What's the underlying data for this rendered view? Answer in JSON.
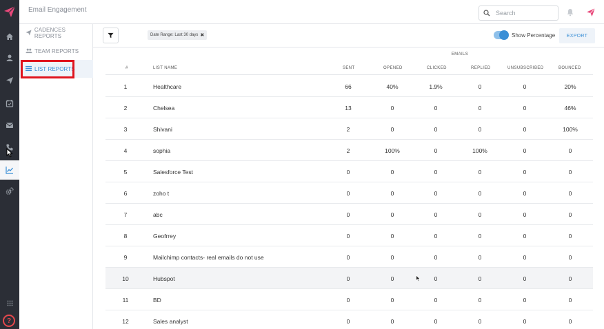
{
  "app": {
    "title": "Email Engagement",
    "brand_color": "#e8487a",
    "accent_color": "#3b8fd6"
  },
  "header": {
    "search_placeholder": "Search",
    "icons": [
      "search-icon",
      "bell-icon",
      "logo-icon"
    ]
  },
  "rail": {
    "items": [
      "home-icon",
      "user-icon",
      "send-icon",
      "calendar-icon",
      "mail-icon",
      "phone-icon",
      "chart-icon",
      "settings-icon"
    ],
    "active": "chart-icon"
  },
  "subnav": {
    "items": [
      {
        "label": "CADENCES REPORTS",
        "icon": "send-icon",
        "active": false
      },
      {
        "label": "TEAM REPORTS",
        "icon": "team-icon",
        "active": false
      },
      {
        "label": "LIST REPORTS",
        "icon": "list-icon",
        "active": true
      }
    ]
  },
  "toolbar": {
    "date_range": "Date Range: Last 30 days",
    "remove": "✖",
    "show_percentage_label": "Show Percentage",
    "show_percentage": true,
    "export_label": "EXPORT"
  },
  "table": {
    "group_header": "EMAILS",
    "columns": {
      "num": "#",
      "name": "LIST NAME",
      "sent": "SENT",
      "opened": "OPENED",
      "clicked": "CLICKED",
      "replied": "REPLIED",
      "unsubscribed": "UNSUBSCRIBED",
      "bounced": "BOUNCED"
    },
    "rows": [
      {
        "num": "1",
        "name": "Healthcare",
        "sent": "66",
        "opened": "40%",
        "clicked": "1.9%",
        "replied": "0",
        "unsubscribed": "0",
        "bounced": "20%"
      },
      {
        "num": "2",
        "name": "Chelsea",
        "sent": "13",
        "opened": "0",
        "clicked": "0",
        "replied": "0",
        "unsubscribed": "0",
        "bounced": "46%"
      },
      {
        "num": "3",
        "name": "Shivani",
        "sent": "2",
        "opened": "0",
        "clicked": "0",
        "replied": "0",
        "unsubscribed": "0",
        "bounced": "100%"
      },
      {
        "num": "4",
        "name": "sophia",
        "sent": "2",
        "opened": "100%",
        "clicked": "0",
        "replied": "100%",
        "unsubscribed": "0",
        "bounced": "0"
      },
      {
        "num": "5",
        "name": "Salesforce Test",
        "sent": "0",
        "opened": "0",
        "clicked": "0",
        "replied": "0",
        "unsubscribed": "0",
        "bounced": "0"
      },
      {
        "num": "6",
        "name": "zoho t",
        "sent": "0",
        "opened": "0",
        "clicked": "0",
        "replied": "0",
        "unsubscribed": "0",
        "bounced": "0"
      },
      {
        "num": "7",
        "name": "abc",
        "sent": "0",
        "opened": "0",
        "clicked": "0",
        "replied": "0",
        "unsubscribed": "0",
        "bounced": "0"
      },
      {
        "num": "8",
        "name": "Geofrrey",
        "sent": "0",
        "opened": "0",
        "clicked": "0",
        "replied": "0",
        "unsubscribed": "0",
        "bounced": "0"
      },
      {
        "num": "9",
        "name": "Mailchimp contacts- real emails do not use",
        "sent": "0",
        "opened": "0",
        "clicked": "0",
        "replied": "0",
        "unsubscribed": "0",
        "bounced": "0"
      },
      {
        "num": "10",
        "name": "Hubspot",
        "sent": "0",
        "opened": "0",
        "clicked": "0",
        "replied": "0",
        "unsubscribed": "0",
        "bounced": "0"
      },
      {
        "num": "11",
        "name": "BD",
        "sent": "0",
        "opened": "0",
        "clicked": "0",
        "replied": "0",
        "unsubscribed": "0",
        "bounced": "0"
      },
      {
        "num": "12",
        "name": "Sales analyst",
        "sent": "0",
        "opened": "0",
        "clicked": "0",
        "replied": "0",
        "unsubscribed": "0",
        "bounced": "0"
      }
    ]
  }
}
